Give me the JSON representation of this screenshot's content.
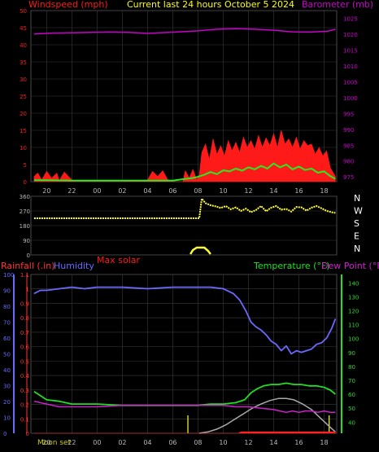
{
  "colors": {
    "background": "#000000",
    "frame": "#4a4a4a",
    "grid": "#3a3a3a",
    "tick": "#b8b8b8",
    "title": "#ffff00",
    "wind": "#ff1a1a",
    "gust_fill": "#ff1a1a",
    "wind_avg": "#22ee22",
    "barometer": "#cc00cc",
    "direction": "#ffff33",
    "solar": "#ffff33",
    "rain_axis": "#ff3333",
    "humidity": "#6a6aff",
    "humidity_axis": "#6a6aff",
    "temperature": "#22dd22",
    "temp_axis": "#22dd22",
    "dewpoint": "#cc22cc",
    "maxsolar": "#aaaaaa",
    "rain_line": "#ff2020",
    "moon_text": "#cccc00"
  },
  "chart_data": [
    {
      "type": "line",
      "title": "Current last 24 hours October 5 2024",
      "left_label": "Windspeed (mph)",
      "right_label": "Barometer (mb)",
      "x_ticks": [
        "20",
        "22",
        "00",
        "02",
        "04",
        "06",
        "08",
        "10",
        "12",
        "14",
        "16",
        "18"
      ],
      "x_tick_hours": [
        20,
        22,
        24,
        26,
        28,
        30,
        32,
        34,
        36,
        38,
        40,
        42
      ],
      "x_range": [
        18.75,
        43.0
      ],
      "y_left_ticks": [
        "0",
        "5",
        "10",
        "15",
        "20",
        "25",
        "30",
        "35",
        "40",
        "45",
        "50"
      ],
      "ylim_left": [
        0,
        50
      ],
      "y_right_ticks": [
        "975",
        "980",
        "985",
        "990",
        "995",
        "1000",
        "1005",
        "1010",
        "1015",
        "1020",
        "1025"
      ],
      "ylim_right": [
        973.5,
        1027.5
      ],
      "series": [
        {
          "key": "barometer",
          "axis": "right",
          "x": [
            19.0,
            20.5,
            22.0,
            23.5,
            25.0,
            26.5,
            28.0,
            29.0,
            30.5,
            32.0,
            33.5,
            35.0,
            36.5,
            38.0,
            39.5,
            41.0,
            42.3,
            42.9
          ],
          "y": [
            1020.1,
            1020.4,
            1020.5,
            1020.6,
            1020.7,
            1020.6,
            1020.3,
            1020.5,
            1020.8,
            1021.1,
            1021.6,
            1021.8,
            1021.6,
            1021.3,
            1020.8,
            1020.7,
            1021.0,
            1021.6
          ]
        },
        {
          "key": "gust",
          "axis": "left",
          "x": [
            19.0,
            19.3,
            19.6,
            20.0,
            20.4,
            20.8,
            21.0,
            21.4,
            21.8,
            22.2,
            23.0,
            24.0,
            26.0,
            28.0,
            28.4,
            28.8,
            29.2,
            29.6,
            30.0,
            30.5,
            30.8,
            31.0,
            31.3,
            31.6,
            31.9,
            32.1,
            32.3,
            32.6,
            32.9,
            33.2,
            33.5,
            33.8,
            34.1,
            34.4,
            34.7,
            35.0,
            35.3,
            35.6,
            35.9,
            36.2,
            36.5,
            36.8,
            37.1,
            37.4,
            37.7,
            38.0,
            38.3,
            38.6,
            38.9,
            39.2,
            39.5,
            39.8,
            40.1,
            40.4,
            40.7,
            41.0,
            41.3,
            41.6,
            41.9,
            42.2,
            42.5,
            42.9
          ],
          "y": [
            1.5,
            2.5,
            0.5,
            3.0,
            1.0,
            2.5,
            0.3,
            2.8,
            1.2,
            0,
            0,
            0,
            0,
            0.5,
            3.0,
            1.5,
            3.2,
            0.6,
            0,
            0,
            0,
            3.2,
            1.0,
            3.6,
            0.5,
            2.0,
            8.5,
            11.0,
            6.5,
            12.5,
            8.0,
            10.5,
            7.5,
            12.0,
            9.0,
            11.5,
            8.5,
            13.0,
            10.0,
            12.0,
            9.5,
            13.5,
            10.0,
            12.8,
            10.5,
            14.0,
            10.0,
            15.0,
            11.0,
            12.5,
            10.0,
            13.0,
            9.5,
            12.0,
            10.5,
            11.0,
            8.0,
            10.0,
            7.5,
            9.0,
            4.0,
            1.5
          ]
        },
        {
          "key": "wind_avg",
          "axis": "left",
          "x": [
            19.0,
            20.0,
            22.0,
            24.0,
            26.0,
            28.0,
            30.0,
            31.0,
            31.5,
            32.0,
            32.5,
            33.0,
            33.5,
            34.0,
            34.5,
            35.0,
            35.5,
            36.0,
            36.5,
            37.0,
            37.5,
            38.0,
            38.5,
            39.0,
            39.5,
            40.0,
            40.5,
            41.0,
            41.5,
            42.0,
            42.5,
            42.9
          ],
          "y": [
            0.4,
            0.4,
            0.3,
            0.3,
            0.3,
            0.3,
            0.3,
            0.8,
            1.0,
            1.4,
            2.0,
            2.8,
            2.2,
            3.3,
            3.0,
            3.8,
            3.2,
            4.2,
            3.6,
            4.6,
            3.8,
            5.3,
            4.2,
            5.0,
            3.6,
            4.4,
            3.4,
            3.8,
            2.6,
            3.0,
            1.6,
            0.8
          ]
        }
      ]
    },
    {
      "type": "scatter",
      "direction_labels": [
        "N",
        "W",
        "S",
        "E",
        "N"
      ],
      "y_ticks": [
        "360",
        "270",
        "180",
        "90",
        "0"
      ],
      "ylim": [
        0,
        360
      ],
      "series": [
        {
          "key": "direction",
          "x": [
            19.0,
            21.0,
            23.0,
            25.0,
            27.0,
            29.0,
            31.0,
            32.1,
            32.15,
            32.2,
            32.25,
            32.3,
            32.6,
            33.0,
            33.4,
            33.8,
            34.2,
            34.6,
            35.0,
            35.4,
            35.8,
            36.2,
            36.6,
            37.0,
            37.4,
            37.8,
            38.2,
            38.6,
            39.0,
            39.4,
            39.8,
            40.2,
            40.6,
            41.0,
            41.4,
            41.8,
            42.2,
            42.6,
            42.9
          ],
          "y": [
            225,
            225,
            225,
            225,
            225,
            225,
            225,
            225,
            255,
            285,
            315,
            345,
            318,
            305,
            298,
            288,
            300,
            280,
            292,
            270,
            284,
            262,
            276,
            300,
            268,
            290,
            300,
            278,
            282,
            266,
            294,
            292,
            272,
            290,
            300,
            286,
            270,
            262,
            258
          ]
        },
        {
          "key": "solar",
          "x": [
            31.4,
            31.6,
            31.9,
            32.2,
            32.5,
            32.8,
            33.0
          ],
          "y": [
            5,
            30,
            45,
            45,
            45,
            25,
            5
          ]
        }
      ]
    },
    {
      "type": "line",
      "rain_label": "Rainfall (.in)",
      "humidity_label": "Humidity",
      "solar_label": "Max solar",
      "temp_label": "Temperature (°F)",
      "dew_label": "Dew Point (°F)",
      "moon_label": "Moon set",
      "x_ticks": [
        "20",
        "22",
        "00",
        "02",
        "04",
        "06",
        "08",
        "10",
        "12",
        "14",
        "16",
        "18"
      ],
      "x_tick_hours": [
        20,
        22,
        24,
        26,
        28,
        30,
        32,
        34,
        36,
        38,
        40,
        42
      ],
      "humidity_ticks": [
        "0",
        "10",
        "20",
        "30",
        "40",
        "50",
        "60",
        "70",
        "80",
        "90",
        "100"
      ],
      "ylim_humidity": [
        0,
        100
      ],
      "rain_ticks": [
        "0",
        "0.1",
        "0.2",
        "0.3",
        "0.4",
        "0.5",
        "0.6",
        "0.7",
        "0.8",
        "0.9",
        "1",
        "1.1"
      ],
      "ylim_rain": [
        0,
        1.1
      ],
      "temp_ticks": [
        "40",
        "50",
        "60",
        "70",
        "80",
        "90",
        "100",
        "110",
        "120",
        "130",
        "140"
      ],
      "ylim_temp": [
        32,
        146
      ],
      "series": [
        {
          "key": "humidity",
          "axis": "humidity",
          "x": [
            19.0,
            19.5,
            20.0,
            21.0,
            22.0,
            23.0,
            24.0,
            26.0,
            28.0,
            30.0,
            32.0,
            33.0,
            34.0,
            34.8,
            35.3,
            35.8,
            36.2,
            36.6,
            37.0,
            37.4,
            37.8,
            38.2,
            38.6,
            39.0,
            39.4,
            39.8,
            40.2,
            40.6,
            41.0,
            41.4,
            41.8,
            42.2,
            42.6,
            42.9
          ],
          "y": [
            88,
            90,
            90,
            91,
            92,
            91,
            92,
            92,
            91,
            92,
            92,
            92,
            91,
            88,
            84,
            77,
            70,
            67,
            65,
            62,
            58,
            56,
            52,
            55,
            50,
            52,
            51,
            52,
            53,
            56,
            57,
            60,
            66,
            72
          ]
        },
        {
          "key": "temperature",
          "axis": "temp",
          "x": [
            19.0,
            19.5,
            20.0,
            21.0,
            22.0,
            24.0,
            26.0,
            28.0,
            30.0,
            32.0,
            33.0,
            34.0,
            35.0,
            35.7,
            36.2,
            36.7,
            37.2,
            37.8,
            38.4,
            39.0,
            39.6,
            40.2,
            40.8,
            41.4,
            42.0,
            42.5,
            42.9
          ],
          "y": [
            62,
            59,
            56,
            55,
            53,
            53,
            52,
            52,
            52,
            52,
            53,
            53,
            54,
            56,
            61,
            64,
            66,
            67,
            67,
            68,
            67,
            67,
            66,
            66,
            65,
            63,
            60
          ]
        },
        {
          "key": "dewpoint",
          "axis": "temp",
          "x": [
            19.0,
            20.0,
            21.0,
            22.0,
            24.0,
            26.0,
            28.0,
            30.0,
            32.0,
            34.0,
            35.0,
            36.0,
            37.0,
            38.0,
            38.5,
            39.0,
            39.5,
            40.0,
            40.5,
            41.0,
            41.5,
            42.0,
            42.5,
            42.9
          ],
          "y": [
            55,
            53,
            51,
            51,
            51,
            52,
            52,
            52,
            52,
            52,
            51,
            51,
            50,
            49,
            48,
            47,
            48,
            47,
            48,
            48,
            47,
            48,
            47,
            47
          ]
        },
        {
          "key": "maxsolar",
          "axis": "temp",
          "x": [
            32.1,
            32.8,
            33.5,
            34.2,
            34.9,
            35.6,
            36.3,
            37.0,
            37.7,
            38.4,
            39.0,
            39.6,
            40.3,
            41.0,
            41.7,
            42.4,
            42.9
          ],
          "y": [
            32,
            33,
            35,
            38,
            42,
            46,
            50,
            53,
            55.5,
            57,
            57,
            56,
            53,
            49,
            43,
            37,
            33
          ]
        },
        {
          "key": "rain",
          "axis": "rain",
          "x": [
            19.0,
            34.0,
            35.2,
            35.4,
            42.9
          ],
          "y": [
            0,
            0,
            0,
            0.01,
            0.01
          ]
        }
      ]
    }
  ]
}
